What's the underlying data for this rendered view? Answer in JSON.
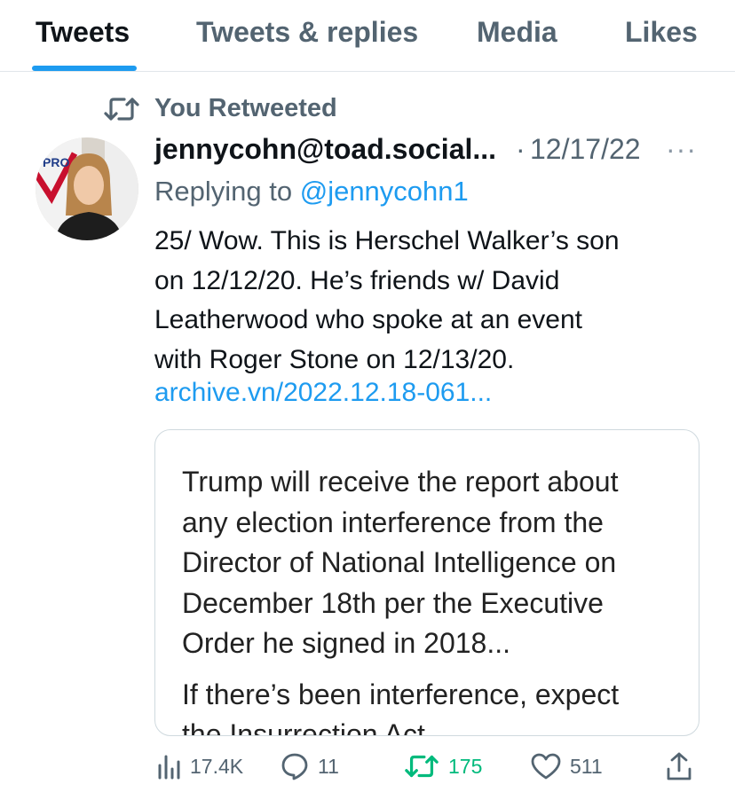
{
  "tabs": [
    {
      "label": "Tweets",
      "active": true
    },
    {
      "label": "Tweets & replies",
      "active": false
    },
    {
      "label": "Media",
      "active": false
    },
    {
      "label": "Likes",
      "active": false
    }
  ],
  "retweet_context": {
    "label": "You Retweeted",
    "icon": "retweet-icon"
  },
  "tweet": {
    "author": "jennycohn@toad.social...",
    "separator": "·",
    "date": "12/17/22",
    "more": "···",
    "replying_prefix": "Replying to ",
    "replying_handle": "@jennycohn1",
    "text_lines": [
      "25/ Wow. This is Herschel Walker’s son",
      "on 12/12/20. He’s friends w/ David",
      "Leatherwood who spoke at an event",
      "with Roger Stone on 12/13/20."
    ],
    "link": "archive.vn/2022.12.18-061...",
    "avatar_badge_text": "PRO"
  },
  "card": {
    "lines": [
      "Trump will receive the report about",
      "any election interference from the",
      "Director of National Intelligence on",
      "December 18th per the Executive",
      "Order he signed in 2018...",
      "If there’s been interference, expect",
      "the Insurrection Act"
    ]
  },
  "actions": {
    "views": {
      "count": "17.4K",
      "icon": "views-chart-icon"
    },
    "replies": {
      "count": "11",
      "icon": "reply-bubble-icon"
    },
    "retweets": {
      "count": "175",
      "icon": "retweet-icon",
      "active": true
    },
    "likes": {
      "count": "511",
      "icon": "heart-icon"
    },
    "share": {
      "icon": "share-icon"
    }
  },
  "colors": {
    "accent": "#1d9bf0",
    "retweet_green": "#00ba7c",
    "text": "#0f1419",
    "secondary": "#536471"
  }
}
